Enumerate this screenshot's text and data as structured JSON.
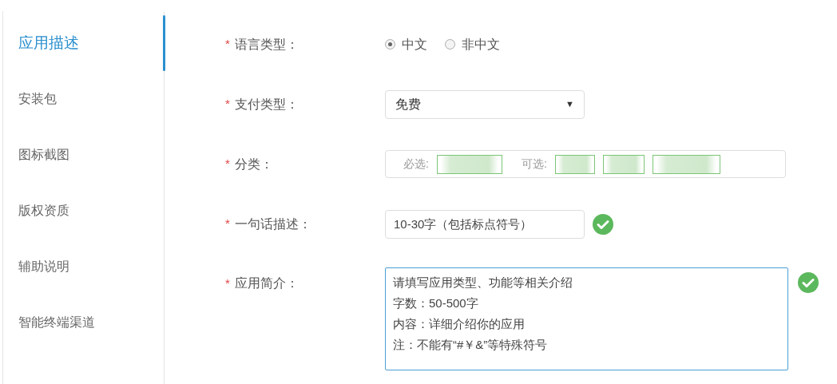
{
  "sidebar": {
    "items": [
      {
        "label": "应用描述",
        "selected": true
      },
      {
        "label": "安装包",
        "selected": false
      },
      {
        "label": "图标截图",
        "selected": false
      },
      {
        "label": "版权资质",
        "selected": false
      },
      {
        "label": "辅助说明",
        "selected": false
      },
      {
        "label": "智能终端渠道",
        "selected": false
      }
    ]
  },
  "form": {
    "fields": [
      {
        "kind": "radio",
        "required_mark": "*",
        "label": "语言类型：",
        "options": [
          {
            "label": "中文",
            "selected": true
          },
          {
            "label": "非中文",
            "selected": false
          }
        ]
      },
      {
        "kind": "select",
        "required_mark": "*",
        "label": "支付类型：",
        "value": "免费",
        "caret": "▼"
      },
      {
        "kind": "category",
        "required_mark": "*",
        "label": "分类：",
        "required_label": "必选:",
        "optional_label": "可选:",
        "required_chips": [
          {
            "kind": "redacted"
          }
        ],
        "optional_chips": [
          {
            "kind": "redacted"
          },
          {
            "kind": "redacted"
          },
          {
            "kind": "redacted"
          }
        ]
      },
      {
        "kind": "input",
        "required_mark": "*",
        "label": "一句话描述：",
        "placeholder": "10-30字（包括标点符号）",
        "valid": true
      },
      {
        "kind": "textarea",
        "required_mark": "*",
        "label": "应用简介：",
        "placeholder_lines": [
          "请填写应用类型、功能等相关介绍",
          "字数：50-500字",
          "内容：详细介绍你的应用",
          "注：不能有“#￥&”等特殊符号"
        ],
        "valid": true
      }
    ]
  }
}
